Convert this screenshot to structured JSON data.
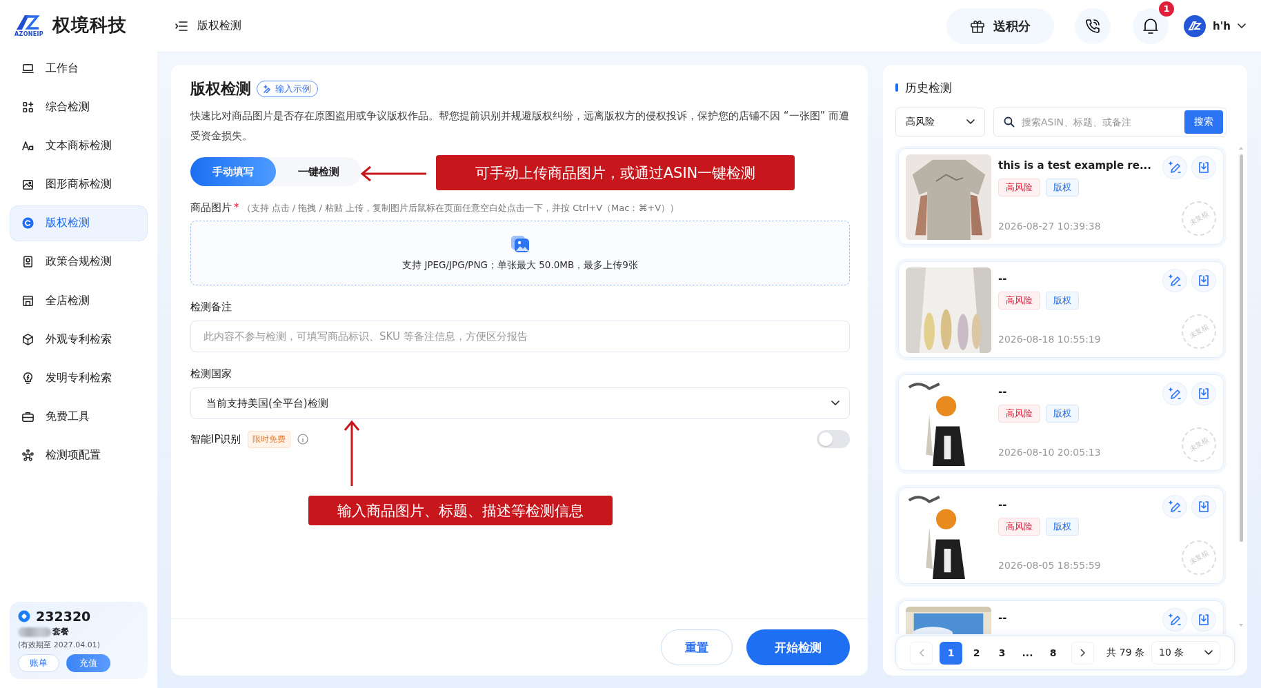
{
  "sidebar": {
    "brand": {
      "name": "权境科技",
      "logo_caption": "AZONEIP"
    },
    "items": [
      {
        "label": "工作台",
        "selected": false
      },
      {
        "label": "综合检测",
        "selected": false
      },
      {
        "label": "文本商标检测",
        "selected": false
      },
      {
        "label": "图形商标检测",
        "selected": false
      },
      {
        "label": "版权检测",
        "selected": true
      },
      {
        "label": "政策合规检测",
        "selected": false
      },
      {
        "label": "全店检测",
        "selected": false
      },
      {
        "label": "外观专利检索",
        "selected": false
      },
      {
        "label": "发明专利检索",
        "selected": false
      },
      {
        "label": "免费工具",
        "selected": false
      },
      {
        "label": "检测项配置",
        "selected": false
      }
    ],
    "account": {
      "points": "232320",
      "plan": "套餐",
      "validity": "(有效期至 2027.04.01)",
      "buttons": [
        "账单",
        "充值"
      ]
    }
  },
  "header": {
    "title": "版权检测",
    "gift_button": "送积分",
    "notification_count": "1",
    "user": "h'h"
  },
  "form": {
    "title": "版权检测",
    "example_button": "输入示例",
    "description": "快速比对商品图片是否存在原图盗用或争议版权作品。帮您提前识别并规避版权纠纷，远离版权方的侵权投诉，保护您的店铺不因 “一张图” 而遭受资金损失。",
    "mode_tabs": [
      {
        "label": "手动填写",
        "selected": true
      },
      {
        "label": "一键检测",
        "selected": false
      }
    ],
    "image_field": {
      "label": "商品图片",
      "required_mark": "*",
      "hint": "（支持 点击 / 拖拽 / 粘贴 上传，复制图片后鼠标在页面任意空白处点击一下，并按 Ctrl+V（Mac：⌘+V））",
      "upload_text": "支持 JPEG/JPG/PNG；单张最大 50.0MB，最多上传9张"
    },
    "note_field": {
      "label": "检测备注",
      "placeholder": "此内容不参与检测，可填写商品标识、SKU 等备注信息，方便区分报告"
    },
    "country_field": {
      "label": "检测国家",
      "value": "当前支持美国(全平台)检测"
    },
    "ip_recognition": {
      "label": "智能IP识别",
      "badge": "限时免费",
      "on": false
    },
    "buttons": [
      "重置",
      "开始检测"
    ],
    "annotations": [
      {
        "kind": "left",
        "text": "可手动上传商品图片，或通过ASIN一键检测"
      },
      {
        "kind": "up",
        "text": "输入商品图片、标题、描述等检测信息"
      }
    ]
  },
  "history": {
    "title": "历史检测",
    "filter": "高风险",
    "search": {
      "placeholder": "搜索ASIN、标题、或备注",
      "button": "搜索"
    },
    "records": [
      {
        "title": "this is a test example re...",
        "tags": [
          {
            "kind": "risk",
            "label": "高风险"
          },
          {
            "kind": "type",
            "label": "版权"
          }
        ],
        "time": "2026-08-27 10:39:38",
        "stamp": "未复核"
      },
      {
        "title": "--",
        "tags": [
          {
            "kind": "risk",
            "label": "高风险"
          },
          {
            "kind": "type",
            "label": "版权"
          }
        ],
        "time": "2026-08-18 10:55:19",
        "stamp": "未复核"
      },
      {
        "title": "--",
        "tags": [
          {
            "kind": "risk",
            "label": "高风险"
          },
          {
            "kind": "type",
            "label": "版权"
          }
        ],
        "time": "2026-08-10 20:05:13",
        "stamp": "未复核"
      },
      {
        "title": "--",
        "tags": [
          {
            "kind": "risk",
            "label": "高风险"
          },
          {
            "kind": "type",
            "label": "版权"
          }
        ],
        "time": "2026-08-05 18:55:59",
        "stamp": "未复核"
      },
      {
        "title": "--"
      }
    ],
    "pagination": {
      "pages": [
        {
          "label": "1",
          "selected": true
        },
        {
          "label": "2",
          "selected": false
        },
        {
          "label": "3",
          "selected": false
        },
        {
          "label": "...",
          "selected": false
        },
        {
          "label": "8",
          "selected": false
        }
      ],
      "total": "共 79 条",
      "page_size": "10 条"
    }
  }
}
